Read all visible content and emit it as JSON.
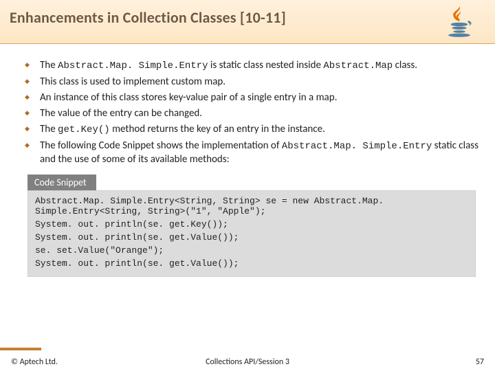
{
  "header": {
    "title": "Enhancements in Collection Classes [10-11]"
  },
  "bullets": [
    {
      "pre": "The ",
      "code1": "Abstract.Map. Simple.Entry",
      "mid": " is static class nested inside ",
      "code2": "Abstract.Map",
      "post": " class."
    },
    {
      "text": "This class is used to implement custom map."
    },
    {
      "text": "An instance of this class stores key-value pair of a single entry in a map."
    },
    {
      "text": "The value of the entry can be changed."
    },
    {
      "pre": "The ",
      "code1": "get.Key()",
      "post": "  method returns the key of an entry in the instance."
    },
    {
      "pre": "The following Code Snippet shows the implementation of ",
      "code1": "Abstract.Map. Simple.Entry",
      "post": " static class and the use of some of its available methods:"
    }
  ],
  "snippet": {
    "label": "Code Snippet",
    "lines": [
      "Abstract.Map. Simple.Entry<String, String> se = new Abstract.Map. Simple.Entry<String, String>(\"1\", \"Apple\");",
      "System. out. println(se. get.Key());",
      "System. out. println(se. get.Value());",
      "se. set.Value(\"Orange\");",
      "System. out. println(se. get.Value());"
    ]
  },
  "footer": {
    "left": "© Aptech Ltd.",
    "center": "Collections API/Session 3",
    "right": "57"
  }
}
